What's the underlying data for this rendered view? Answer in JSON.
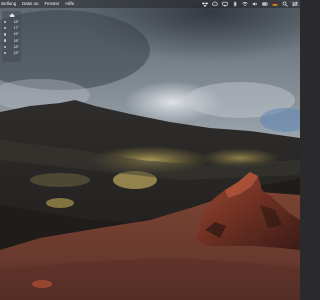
{
  "menubar": {
    "items": [
      "stellung",
      "Datei ou",
      "Fenster",
      "Hilfe"
    ],
    "status_icons": [
      "dropbox-icon",
      "creative-cloud-icon",
      "display-icon",
      "bluetooth-icon",
      "wifi-icon",
      "volume-icon",
      "battery-icon",
      "flag-icon",
      "search-icon",
      "control-center-icon"
    ]
  },
  "weather_widget": {
    "icon": "cloud-icon",
    "temps": [
      "18°",
      "17°",
      "16°",
      "18°",
      "18°",
      "18°"
    ]
  },
  "colors": {
    "menubar_bg": "#2a2c30",
    "sky": "#7d8590",
    "mountain": "#2b2a28",
    "ground": "#6e3c2e"
  }
}
